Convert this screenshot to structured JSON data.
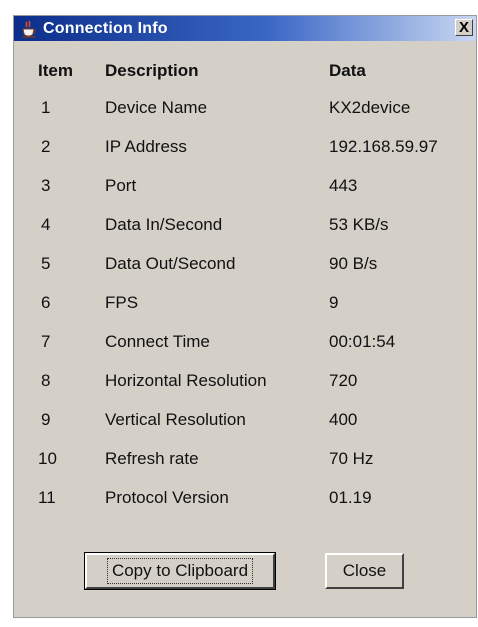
{
  "window": {
    "title": "Connection Info",
    "close_label": "X",
    "icon": "java-coffee-icon"
  },
  "table": {
    "headers": {
      "item": "Item",
      "description": "Description",
      "data": "Data"
    },
    "rows": [
      {
        "item": "1",
        "description": "Device Name",
        "data": "KX2device"
      },
      {
        "item": "2",
        "description": "IP Address",
        "data": "192.168.59.97"
      },
      {
        "item": "3",
        "description": "Port",
        "data": "443"
      },
      {
        "item": "4",
        "description": "Data In/Second",
        "data": "53 KB/s"
      },
      {
        "item": "5",
        "description": "Data Out/Second",
        "data": "90 B/s"
      },
      {
        "item": "6",
        "description": "FPS",
        "data": "9"
      },
      {
        "item": "7",
        "description": "Connect Time",
        "data": "00:01:54"
      },
      {
        "item": "8",
        "description": "Horizontal Resolution",
        "data": "720"
      },
      {
        "item": "9",
        "description": "Vertical Resolution",
        "data": "400"
      },
      {
        "item": "10",
        "description": "Refresh rate",
        "data": "70 Hz"
      },
      {
        "item": "11",
        "description": "Protocol Version",
        "data": "01.19"
      }
    ]
  },
  "buttons": {
    "copy_label": "Copy to Clipboard",
    "close_label": "Close"
  },
  "colors": {
    "titlebar_start": "#0b2e8a",
    "titlebar_end": "#c9d7f2",
    "window_background": "#d4d0c8"
  }
}
